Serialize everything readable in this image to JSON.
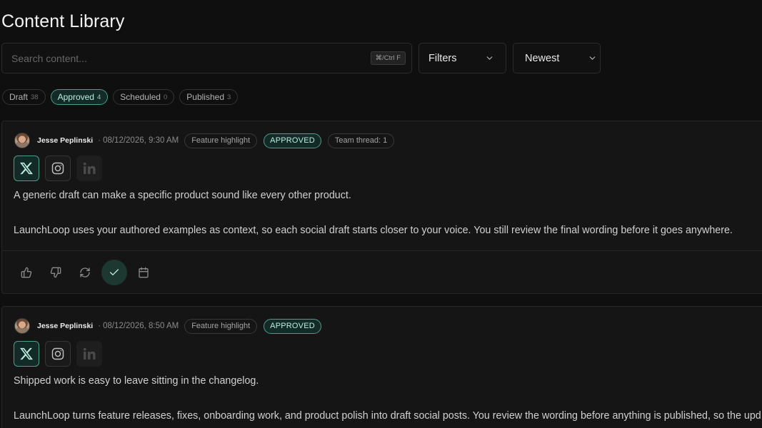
{
  "page": {
    "title": "Content Library"
  },
  "search": {
    "placeholder": "Search content...",
    "value": "",
    "shortcut": "⌘/Ctrl F"
  },
  "filters": {
    "label": "Filters",
    "icon": "chevron-down-icon"
  },
  "sort": {
    "selected": "Newest",
    "icon": "chevron-down-icon"
  },
  "status_tabs": [
    {
      "label": "Draft",
      "count": "38",
      "active": false
    },
    {
      "label": "Approved",
      "count": "4",
      "active": true
    },
    {
      "label": "Scheduled",
      "count": "0",
      "active": false
    },
    {
      "label": "Published",
      "count": "3",
      "active": false
    }
  ],
  "meta_separator": "·",
  "posts": [
    {
      "author": "Jesse Peplinski",
      "timestamp": "08/12/2026, 9:30 AM",
      "tag": "Feature highlight",
      "status": "APPROVED",
      "thread": "Team thread: 1",
      "platforms": [
        {
          "icon": "x-logo-icon",
          "selected": true,
          "disabled": false
        },
        {
          "icon": "instagram-icon",
          "selected": false,
          "disabled": false
        },
        {
          "icon": "linkedin-icon",
          "selected": false,
          "disabled": true
        }
      ],
      "paragraphs": [
        "A generic draft can make a specific product sound like every other product.",
        "LaunchLoop uses your authored examples as context, so each social draft starts closer to your voice. You still review the final wording before it goes anywhere."
      ],
      "actions": [
        {
          "icon": "thumbs-up-icon",
          "active": false
        },
        {
          "icon": "thumbs-down-icon",
          "active": false
        },
        {
          "icon": "refresh-icon",
          "active": false
        },
        {
          "icon": "check-icon",
          "active": true
        },
        {
          "icon": "calendar-icon",
          "active": false
        }
      ]
    },
    {
      "author": "Jesse Peplinski",
      "timestamp": "08/12/2026, 8:50 AM",
      "tag": "Feature highlight",
      "status": "APPROVED",
      "platforms": [
        {
          "icon": "x-logo-icon",
          "selected": true,
          "disabled": false
        },
        {
          "icon": "instagram-icon",
          "selected": false,
          "disabled": false
        },
        {
          "icon": "linkedin-icon",
          "selected": false,
          "disabled": true
        }
      ],
      "paragraphs": [
        "Shipped work is easy to leave sitting in the changelog.",
        "LaunchLoop turns feature releases, fixes, onboarding work, and product polish into draft social posts. You review the wording before anything is published, so the upd"
      ]
    }
  ],
  "colors": {
    "background": "#0f0f0f",
    "card": "#151515",
    "border": "#262626",
    "text": "#d0d0d0",
    "muted": "#8a8a8a",
    "accent_border": "#4d9c8c",
    "accent_bg": "#132b26",
    "accent_text": "#bcece0"
  }
}
